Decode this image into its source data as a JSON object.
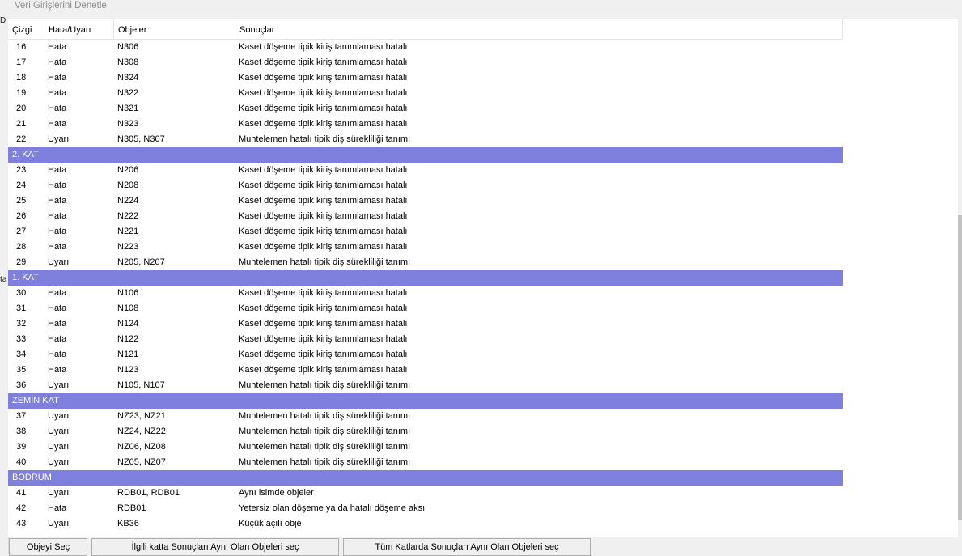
{
  "window": {
    "title": "Veri Girişlerini Denetle"
  },
  "left_fragments": [
    "D",
    "ta"
  ],
  "columns": [
    "Çizgi",
    "Hata/Uyarı",
    "Objeler",
    "Sonuçlar"
  ],
  "rows": [
    {
      "n": "16",
      "type": "Hata",
      "objects": "N306",
      "result": "Kaset döşeme tipik kiriş tanımlaması hatalı"
    },
    {
      "n": "17",
      "type": "Hata",
      "objects": "N308",
      "result": "Kaset döşeme tipik kiriş tanımlaması hatalı"
    },
    {
      "n": "18",
      "type": "Hata",
      "objects": "N324",
      "result": "Kaset döşeme tipik kiriş tanımlaması hatalı"
    },
    {
      "n": "19",
      "type": "Hata",
      "objects": "N322",
      "result": "Kaset döşeme tipik kiriş tanımlaması hatalı"
    },
    {
      "n": "20",
      "type": "Hata",
      "objects": "N321",
      "result": "Kaset döşeme tipik kiriş tanımlaması hatalı"
    },
    {
      "n": "21",
      "type": "Hata",
      "objects": "N323",
      "result": "Kaset döşeme tipik kiriş tanımlaması hatalı"
    },
    {
      "n": "22",
      "type": "Uyarı",
      "objects": "N305, N307",
      "result": "Muhtelemen hatalı tipik diş sürekliliği tanımı"
    },
    {
      "group": "2. KAT"
    },
    {
      "n": "23",
      "type": "Hata",
      "objects": "N206",
      "result": "Kaset döşeme tipik kiriş tanımlaması hatalı"
    },
    {
      "n": "24",
      "type": "Hata",
      "objects": "N208",
      "result": "Kaset döşeme tipik kiriş tanımlaması hatalı"
    },
    {
      "n": "25",
      "type": "Hata",
      "objects": "N224",
      "result": "Kaset döşeme tipik kiriş tanımlaması hatalı"
    },
    {
      "n": "26",
      "type": "Hata",
      "objects": "N222",
      "result": "Kaset döşeme tipik kiriş tanımlaması hatalı"
    },
    {
      "n": "27",
      "type": "Hata",
      "objects": "N221",
      "result": "Kaset döşeme tipik kiriş tanımlaması hatalı"
    },
    {
      "n": "28",
      "type": "Hata",
      "objects": "N223",
      "result": "Kaset döşeme tipik kiriş tanımlaması hatalı"
    },
    {
      "n": "29",
      "type": "Uyarı",
      "objects": "N205, N207",
      "result": "Muhtelemen hatalı tipik diş sürekliliği tanımı"
    },
    {
      "group": "1. KAT"
    },
    {
      "n": "30",
      "type": "Hata",
      "objects": "N106",
      "result": "Kaset döşeme tipik kiriş tanımlaması hatalı"
    },
    {
      "n": "31",
      "type": "Hata",
      "objects": "N108",
      "result": "Kaset döşeme tipik kiriş tanımlaması hatalı"
    },
    {
      "n": "32",
      "type": "Hata",
      "objects": "N124",
      "result": "Kaset döşeme tipik kiriş tanımlaması hatalı"
    },
    {
      "n": "33",
      "type": "Hata",
      "objects": "N122",
      "result": "Kaset döşeme tipik kiriş tanımlaması hatalı"
    },
    {
      "n": "34",
      "type": "Hata",
      "objects": "N121",
      "result": "Kaset döşeme tipik kiriş tanımlaması hatalı"
    },
    {
      "n": "35",
      "type": "Hata",
      "objects": "N123",
      "result": "Kaset döşeme tipik kiriş tanımlaması hatalı"
    },
    {
      "n": "36",
      "type": "Uyarı",
      "objects": "N105, N107",
      "result": "Muhtelemen hatalı tipik diş sürekliliği tanımı"
    },
    {
      "group": "ZEMİN KAT"
    },
    {
      "n": "37",
      "type": "Uyarı",
      "objects": "NZ23, NZ21",
      "result": "Muhtelemen hatalı tipik diş sürekliliği tanımı"
    },
    {
      "n": "38",
      "type": "Uyarı",
      "objects": "NZ24, NZ22",
      "result": "Muhtelemen hatalı tipik diş sürekliliği tanımı"
    },
    {
      "n": "39",
      "type": "Uyarı",
      "objects": "NZ06, NZ08",
      "result": "Muhtelemen hatalı tipik diş sürekliliği tanımı"
    },
    {
      "n": "40",
      "type": "Uyarı",
      "objects": "NZ05, NZ07",
      "result": "Muhtelemen hatalı tipik diş sürekliliği tanımı"
    },
    {
      "group": "BODRUM"
    },
    {
      "n": "41",
      "type": "Uyarı",
      "objects": "RDB01, RDB01",
      "result": "Aynı isimde objeler"
    },
    {
      "n": "42",
      "type": "Hata",
      "objects": "RDB01",
      "result": "Yetersiz olan döşeme ya da hatalı döşeme aksı"
    },
    {
      "n": "43",
      "type": "Uyarı",
      "objects": "KB36",
      "result": "Küçük açılı obje"
    }
  ],
  "buttons": {
    "select_object": "Objeyi Seç",
    "select_same_floor": "İlgili katta Sonuçları Aynı Olan Objeleri seç",
    "select_all_floors": "Tüm Katlarda Sonuçları Aynı Olan Objeleri seç"
  },
  "colors": {
    "group_row": "#7f7fde",
    "group_text": "#ffffff"
  }
}
